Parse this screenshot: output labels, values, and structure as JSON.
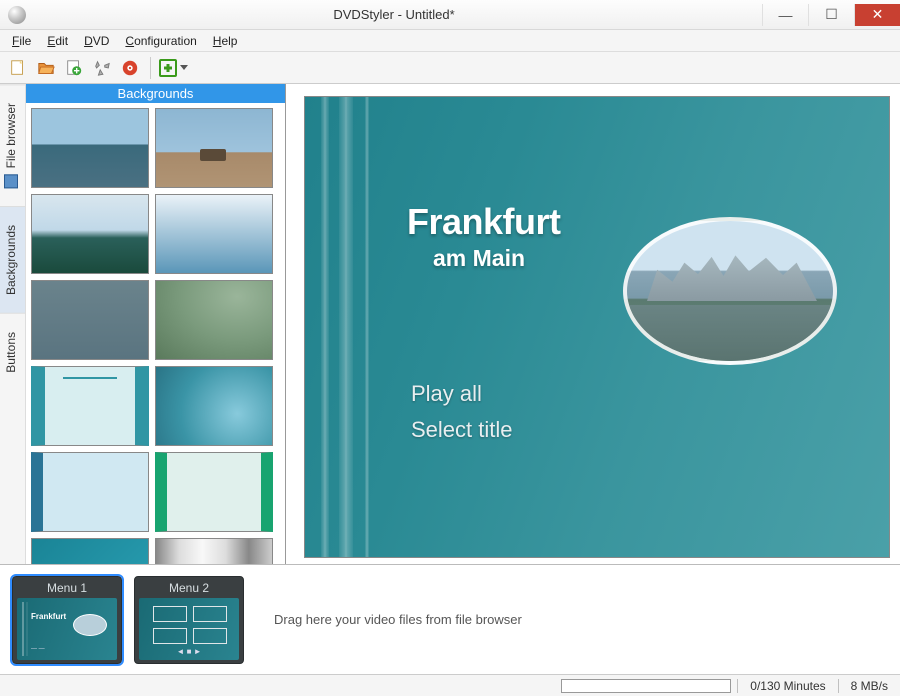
{
  "window": {
    "title": "DVDStyler - Untitled*"
  },
  "menubar": [
    {
      "label": "File",
      "accel": "F"
    },
    {
      "label": "Edit",
      "accel": "E"
    },
    {
      "label": "DVD",
      "accel": "D"
    },
    {
      "label": "Configuration",
      "accel": "C"
    },
    {
      "label": "Help",
      "accel": "H"
    }
  ],
  "sidetabs": {
    "file_browser": "File browser",
    "backgrounds": "Backgrounds",
    "buttons": "Buttons"
  },
  "panel": {
    "header": "Backgrounds"
  },
  "preview": {
    "title": "Frankfurt",
    "subtitle": "am Main",
    "play": "Play all",
    "select": "Select title"
  },
  "menus": [
    {
      "label": "Menu 1"
    },
    {
      "label": "Menu 2"
    }
  ],
  "timeline": {
    "hint": "Drag here your video files from file browser"
  },
  "status": {
    "minutes": "0/130 Minutes",
    "bitrate": "8 MB/s"
  }
}
